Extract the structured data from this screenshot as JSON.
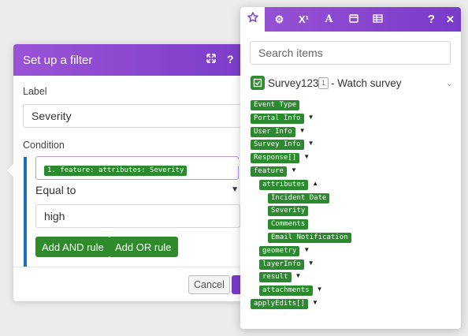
{
  "filter_dialog": {
    "title": "Set up a filter",
    "header_icons": [
      "expand-icon",
      "help-icon"
    ],
    "label_caption": "Label",
    "label_value": "Severity",
    "condition_caption": "Condition",
    "condition_token": "1. feature: attributes: Severity",
    "operator": "Equal to",
    "value": "high",
    "add_and_label": "Add AND rule",
    "add_or_label": "Add OR rule",
    "cancel_label": "Cancel",
    "ok_label": "O"
  },
  "mapping_panel": {
    "tabs": [
      {
        "icon": "star-icon",
        "glyph": "☆",
        "active": true
      },
      {
        "icon": "gear-icon",
        "glyph": "⚙",
        "active": false
      },
      {
        "icon": "superscript-icon",
        "glyph": "X¹",
        "active": false
      },
      {
        "icon": "text-icon",
        "glyph": "A",
        "active": false
      },
      {
        "icon": "calendar-icon",
        "glyph": "▦",
        "active": false
      },
      {
        "icon": "table-icon",
        "glyph": "▤",
        "active": false
      }
    ],
    "help_glyph": "?",
    "close_glyph": "✕",
    "search_placeholder": "Search items",
    "module_name": "Survey123",
    "module_number": "1",
    "module_desc": "- Watch survey",
    "items": [
      {
        "label": "Event Type",
        "depth": 0,
        "arrow": ""
      },
      {
        "label": "Portal Info",
        "depth": 0,
        "arrow": "▼"
      },
      {
        "label": "User Info",
        "depth": 0,
        "arrow": "▼"
      },
      {
        "label": "Survey Info",
        "depth": 0,
        "arrow": "▼"
      },
      {
        "label": "Response[]",
        "depth": 0,
        "arrow": "▼"
      },
      {
        "label": "feature",
        "depth": 0,
        "arrow": "▼"
      },
      {
        "label": "attributes",
        "depth": 1,
        "arrow": "▲"
      },
      {
        "label": "Incident Date",
        "depth": 2,
        "arrow": ""
      },
      {
        "label": "Severity",
        "depth": 2,
        "arrow": ""
      },
      {
        "label": "Comments",
        "depth": 2,
        "arrow": ""
      },
      {
        "label": "Email Notification",
        "depth": 2,
        "arrow": ""
      },
      {
        "label": "geometry",
        "depth": 1,
        "arrow": "▼"
      },
      {
        "label": "layerInfo",
        "depth": 1,
        "arrow": "▼"
      },
      {
        "label": "result",
        "depth": 1,
        "arrow": "▼"
      },
      {
        "label": "attachments",
        "depth": 1,
        "arrow": "▼"
      },
      {
        "label": "applyEdits[]",
        "depth": 0,
        "arrow": "▼"
      }
    ]
  },
  "colors": {
    "header_purple": "#8a47d0",
    "item_green": "#2b8a2e",
    "condition_blue": "#1a73b7"
  }
}
